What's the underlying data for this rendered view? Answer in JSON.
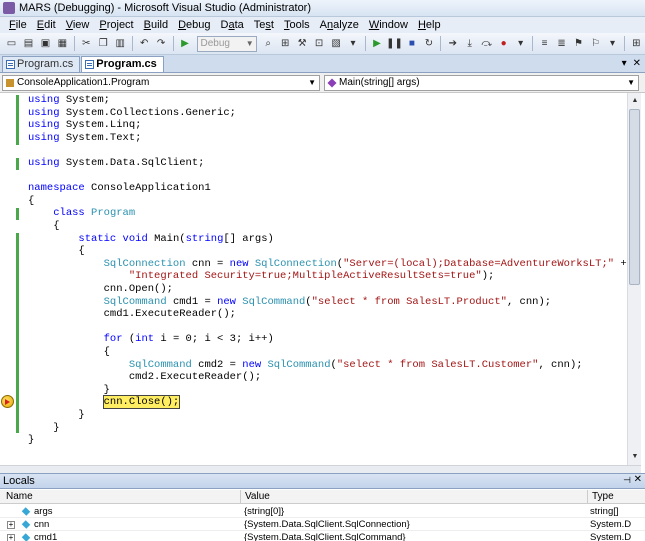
{
  "window": {
    "title": "MARS (Debugging) - Microsoft Visual Studio (Administrator)"
  },
  "menu": [
    {
      "pre": "",
      "u": "F",
      "post": "ile"
    },
    {
      "pre": "",
      "u": "E",
      "post": "dit"
    },
    {
      "pre": "",
      "u": "V",
      "post": "iew"
    },
    {
      "pre": "",
      "u": "P",
      "post": "roject"
    },
    {
      "pre": "",
      "u": "B",
      "post": "uild"
    },
    {
      "pre": "",
      "u": "D",
      "post": "ebug"
    },
    {
      "pre": "D",
      "u": "a",
      "post": "ta"
    },
    {
      "pre": "Te",
      "u": "s",
      "post": "t"
    },
    {
      "pre": "",
      "u": "T",
      "post": "ools"
    },
    {
      "pre": "A",
      "u": "n",
      "post": "alyze"
    },
    {
      "pre": "",
      "u": "W",
      "post": "indow"
    },
    {
      "pre": "",
      "u": "H",
      "post": "elp"
    }
  ],
  "toolbar": {
    "config_value": "Debug"
  },
  "tabs": [
    {
      "label": "Program.cs",
      "active": false
    },
    {
      "label": "Program.cs",
      "active": true
    }
  ],
  "navbar": {
    "type_combo": "ConsoleApplication1.Program",
    "member_combo": "Main(string[] args)"
  },
  "code_lines": [
    [
      [
        "kw",
        "using"
      ],
      [
        "plain",
        " System;"
      ]
    ],
    [
      [
        "kw",
        "using"
      ],
      [
        "plain",
        " System.Collections.Generic;"
      ]
    ],
    [
      [
        "kw",
        "using"
      ],
      [
        "plain",
        " System.Linq;"
      ]
    ],
    [
      [
        "kw",
        "using"
      ],
      [
        "plain",
        " System.Text;"
      ]
    ],
    [],
    [
      [
        "kw",
        "using"
      ],
      [
        "plain",
        " System.Data.SqlClient;"
      ]
    ],
    [],
    [
      [
        "kw",
        "namespace"
      ],
      [
        "plain",
        " ConsoleApplication1"
      ]
    ],
    [
      [
        "plain",
        "{"
      ]
    ],
    [
      [
        "plain",
        "    "
      ],
      [
        "kw",
        "class"
      ],
      [
        "plain",
        " "
      ],
      [
        "ty",
        "Program"
      ]
    ],
    [
      [
        "plain",
        "    {"
      ]
    ],
    [
      [
        "plain",
        "        "
      ],
      [
        "kw",
        "static"
      ],
      [
        "plain",
        " "
      ],
      [
        "kw",
        "void"
      ],
      [
        "plain",
        " Main("
      ],
      [
        "kw",
        "string"
      ],
      [
        "plain",
        "[] args)"
      ]
    ],
    [
      [
        "plain",
        "        {"
      ]
    ],
    [
      [
        "plain",
        "            "
      ],
      [
        "ty",
        "SqlConnection"
      ],
      [
        "plain",
        " cnn = "
      ],
      [
        "kw",
        "new"
      ],
      [
        "plain",
        " "
      ],
      [
        "ty",
        "SqlConnection"
      ],
      [
        "plain",
        "("
      ],
      [
        "st",
        "\"Server=(local);Database=AdventureWorksLT;\""
      ],
      [
        "plain",
        " +"
      ]
    ],
    [
      [
        "plain",
        "                "
      ],
      [
        "st",
        "\"Integrated Security=true;MultipleActiveResultSets=true\""
      ],
      [
        "plain",
        ");"
      ]
    ],
    [
      [
        "plain",
        "            cnn.Open();"
      ]
    ],
    [
      [
        "plain",
        "            "
      ],
      [
        "ty",
        "SqlCommand"
      ],
      [
        "plain",
        " cmd1 = "
      ],
      [
        "kw",
        "new"
      ],
      [
        "plain",
        " "
      ],
      [
        "ty",
        "SqlCommand"
      ],
      [
        "plain",
        "("
      ],
      [
        "st",
        "\"select * from SalesLT.Product\""
      ],
      [
        "plain",
        ", cnn);"
      ]
    ],
    [
      [
        "plain",
        "            cmd1.ExecuteReader();"
      ]
    ],
    [],
    [
      [
        "plain",
        "            "
      ],
      [
        "kw",
        "for"
      ],
      [
        "plain",
        " ("
      ],
      [
        "kw",
        "int"
      ],
      [
        "plain",
        " i = 0; i < 3; i++)"
      ]
    ],
    [
      [
        "plain",
        "            {"
      ]
    ],
    [
      [
        "plain",
        "                "
      ],
      [
        "ty",
        "SqlCommand"
      ],
      [
        "plain",
        " cmd2 = "
      ],
      [
        "kw",
        "new"
      ],
      [
        "plain",
        " "
      ],
      [
        "ty",
        "SqlCommand"
      ],
      [
        "plain",
        "("
      ],
      [
        "st",
        "\"select * from SalesLT.Customer\""
      ],
      [
        "plain",
        ", cnn);"
      ]
    ],
    [
      [
        "plain",
        "                cmd2.ExecuteReader();"
      ]
    ],
    [
      [
        "plain",
        "            }"
      ]
    ],
    [
      [
        "plain",
        "            "
      ],
      [
        "cur",
        "cnn.Close();"
      ]
    ],
    [
      [
        "plain",
        "        }"
      ]
    ],
    [
      [
        "plain",
        "    }"
      ]
    ],
    [
      [
        "plain",
        "}"
      ]
    ]
  ],
  "locals": {
    "title": "Locals",
    "columns": [
      "Name",
      "Value",
      "Type"
    ],
    "rows": [
      {
        "name": "args",
        "value": "{string[0]}",
        "type": "string[]",
        "expandable": false
      },
      {
        "name": "cnn",
        "value": "{System.Data.SqlClient.SqlConnection}",
        "type": "System.D",
        "expandable": true
      },
      {
        "name": "cmd1",
        "value": "{System.Data.SqlClient.SqlCommand}",
        "type": "System.D",
        "expandable": true
      }
    ]
  }
}
